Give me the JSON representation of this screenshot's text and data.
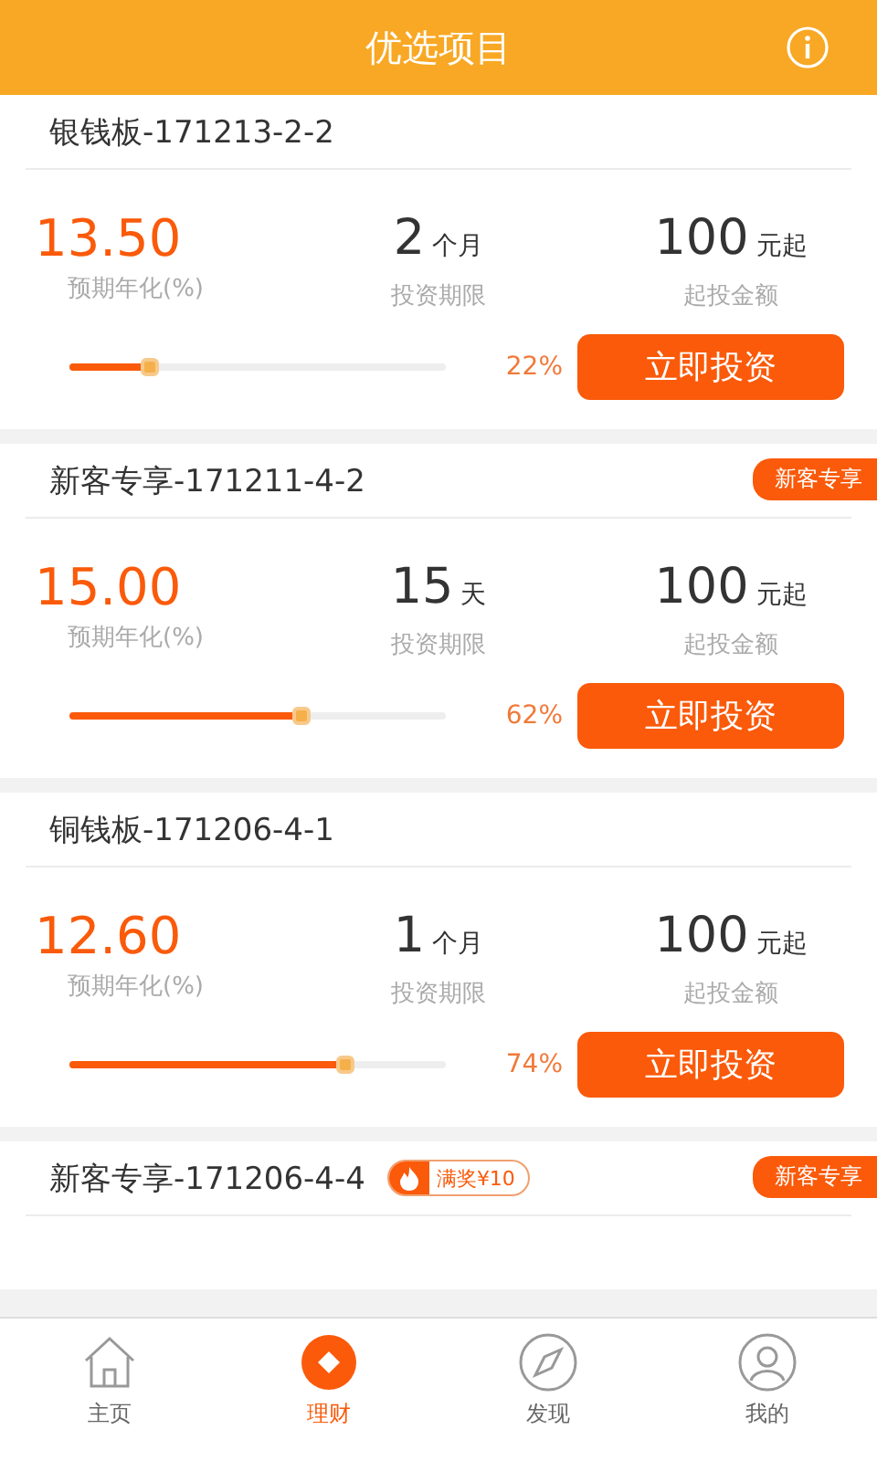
{
  "header": {
    "title": "优选项目"
  },
  "projects": [
    {
      "name": "银钱板-171213-2-2",
      "rate": "13.50",
      "rate_label": "预期年化(%)",
      "term_value": "2",
      "term_unit": "个月",
      "term_label": "投资期限",
      "min_value": "100",
      "min_unit": "元起",
      "min_label": "起投金额",
      "level": 0.22,
      "percent": "22%",
      "button": "立即投资"
    },
    {
      "name": "新客专享-171211-4-2",
      "tag": "新客专享",
      "rate": "15.00",
      "rate_label": "预期年化(%)",
      "term_value": "15",
      "term_unit": "天",
      "term_label": "投资期限",
      "min_value": "100",
      "min_unit": "元起",
      "min_label": "起投金额",
      "level": 0.62,
      "percent": "62%",
      "button": "立即投资"
    },
    {
      "name": "铜钱板-171206-4-1",
      "rate": "12.60",
      "rate_label": "预期年化(%)",
      "term_value": "1",
      "term_unit": "个月",
      "term_label": "投资期限",
      "min_value": "100",
      "min_unit": "元起",
      "min_label": "起投金额",
      "level": 0.74,
      "percent": "74%",
      "button": "立即投资"
    },
    {
      "name": "新客专享-171206-4-4",
      "tag": "新客专享",
      "bonus": "满奖¥10"
    }
  ],
  "tabs": [
    {
      "label": "主页",
      "selected": false
    },
    {
      "label": "理财",
      "selected": true
    },
    {
      "label": "发现",
      "selected": false
    },
    {
      "label": "我的",
      "selected": false
    }
  ]
}
